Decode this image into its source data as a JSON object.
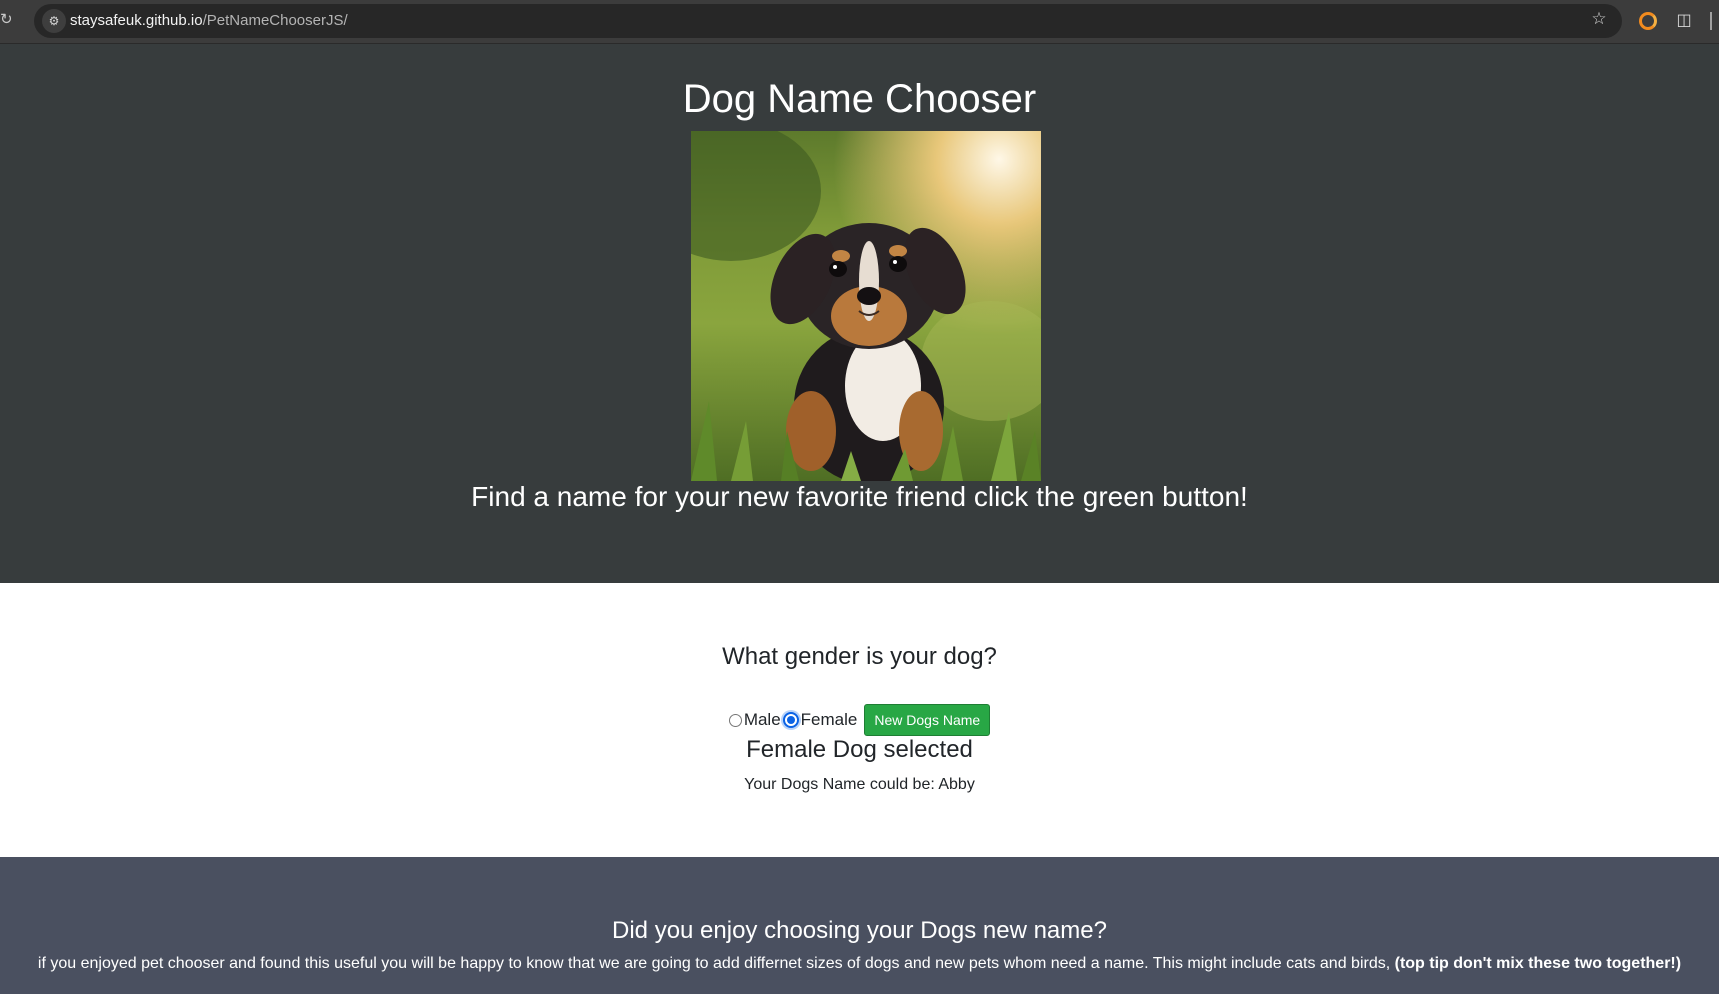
{
  "browser": {
    "url_host": "staysafeuk.github.io",
    "url_path": "/PetNameChooserJS/",
    "reload_icon": "reload-icon",
    "site_info_icon": "tune-icon",
    "bookmark_icon": "star-icon",
    "extensions_icon": "puzzle-icon"
  },
  "hero": {
    "title": "Dog Name Chooser",
    "subtitle": "Find a name for your new favorite friend click the green button!",
    "background": "#373c3d"
  },
  "main": {
    "question": "What gender is your dog?",
    "options": [
      {
        "label": "Male",
        "checked": false
      },
      {
        "label": "Female",
        "checked": true
      }
    ],
    "button_label": "New Dogs Name",
    "button_color": "#28a745",
    "selected_text": "Female Dog selected",
    "result_text": "Your Dogs Name could be: Abby"
  },
  "footer": {
    "title": "Did you enjoy choosing your Dogs new name?",
    "text": "if you enjoyed pet chooser and found this useful you will be happy to know that we are going to add differnet sizes of dogs and new pets whom need a name. This might include cats and birds,",
    "tip": "(top tip don't mix these two together!)",
    "background": "#4a5060"
  }
}
